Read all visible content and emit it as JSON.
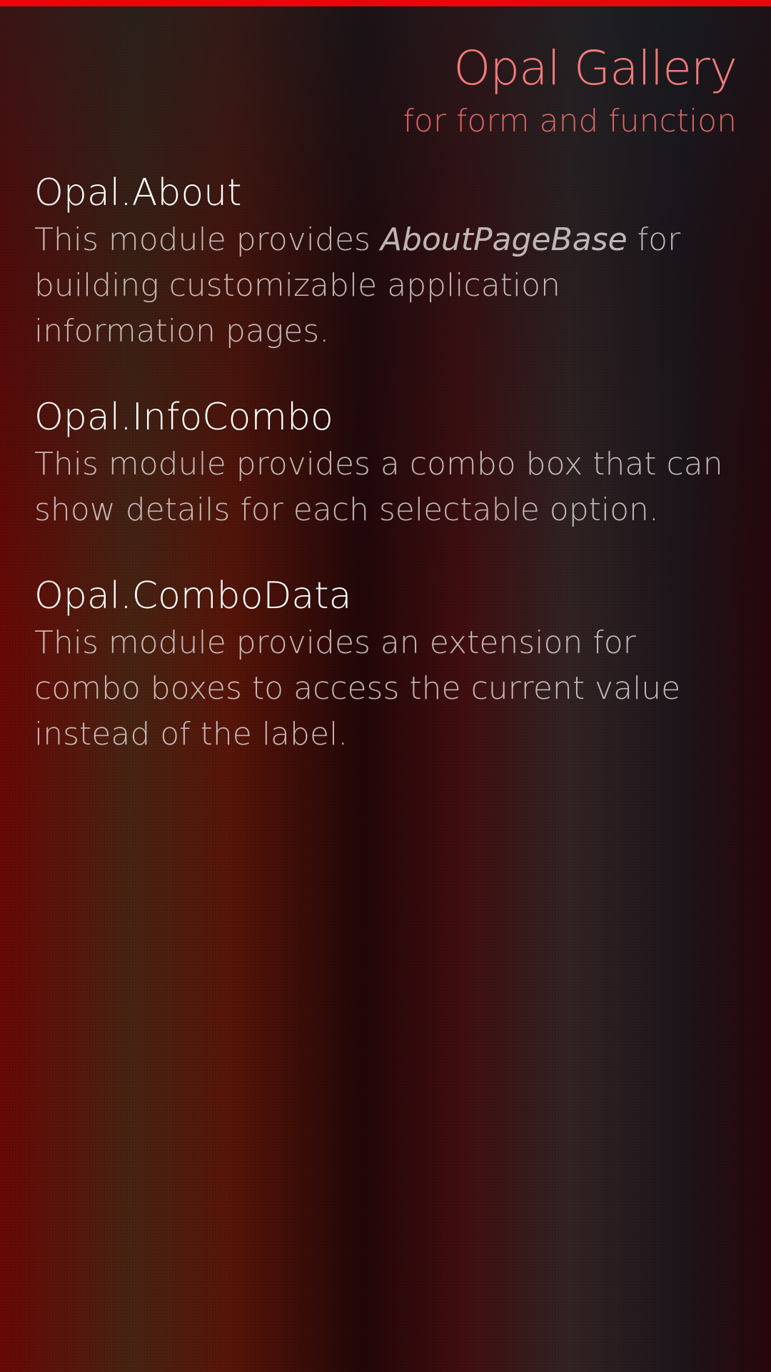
{
  "header": {
    "title": "Opal Gallery",
    "subtitle": "for form and function"
  },
  "modules": [
    {
      "title": "Opal.About",
      "desc_before": "This module provides ",
      "desc_emphasis": "AboutPageBase",
      "desc_after": " for building customizable application information pages."
    },
    {
      "title": "Opal.InfoCombo",
      "desc": "This module provides a combo box that can show details for each selectable option."
    },
    {
      "title": "Opal.ComboData",
      "desc": "This module provides an extension for combo boxes to access the current value instead of the label."
    }
  ],
  "colors": {
    "accent_bar": "#e5070b",
    "title": "#f07a78",
    "subtitle": "#d96563"
  }
}
